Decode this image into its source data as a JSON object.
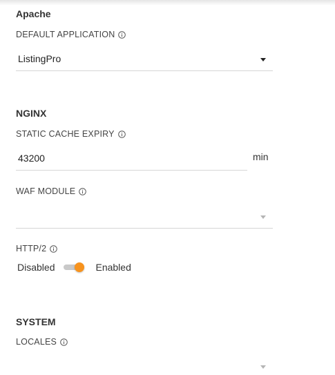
{
  "apache": {
    "title": "Apache",
    "default_application": {
      "label": "DEFAULT APPLICATION",
      "value": "ListingPro"
    }
  },
  "nginx": {
    "title": "NGINX",
    "static_cache_expiry": {
      "label": "STATIC CACHE EXPIRY",
      "value": "43200",
      "unit": "min"
    },
    "waf_module": {
      "label": "WAF MODULE",
      "value": ""
    },
    "http2": {
      "label": "HTTP/2",
      "off_label": "Disabled",
      "on_label": "Enabled",
      "state": "on",
      "accent_color": "#f7931e"
    }
  },
  "system": {
    "title": "SYSTEM",
    "locales": {
      "label": "LOCALES",
      "value": ""
    }
  }
}
